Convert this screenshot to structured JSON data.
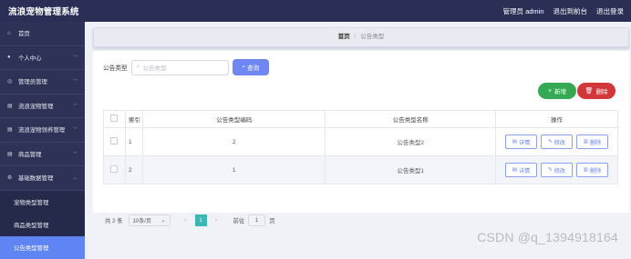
{
  "app": {
    "title": "流浪宠物管理系统"
  },
  "topbar": {
    "user_text": "管理员 admin",
    "to_front": "退出到前台",
    "logout": "退出登录"
  },
  "sidebar": {
    "items": [
      {
        "label": "首页",
        "icon": "home-icon"
      },
      {
        "label": "个人中心",
        "icon": "user-icon"
      },
      {
        "label": "管理员管理",
        "icon": "admin-icon"
      },
      {
        "label": "流浪宠物管理",
        "icon": "list-icon"
      },
      {
        "label": "流浪宠物领养管理",
        "icon": "list-icon"
      },
      {
        "label": "商品管理",
        "icon": "list-icon"
      },
      {
        "label": "基础数据管理",
        "icon": "settings-icon"
      }
    ],
    "sub_items": [
      {
        "label": "宠物类型管理"
      },
      {
        "label": "商品类型管理"
      },
      {
        "label": "公告类型管理",
        "active": true
      }
    ]
  },
  "breadcrumb": {
    "home": "首页",
    "separator": "/",
    "current": "公告类型"
  },
  "search": {
    "label": "公告类型",
    "placeholder": "公告类型",
    "button": "查询"
  },
  "actions": {
    "add": "新增",
    "delete": "删除"
  },
  "table": {
    "headers": {
      "index": "索引",
      "code": "公告类型编码",
      "name": "公告类型名称",
      "ops": "操作"
    },
    "rows": [
      {
        "index": "1",
        "code": "2",
        "name": "公告类型2"
      },
      {
        "index": "2",
        "code": "1",
        "name": "公告类型1"
      }
    ],
    "row_buttons": {
      "detail": "详情",
      "edit": "修改",
      "delete": "删除"
    }
  },
  "pagination": {
    "total": "共 2 条",
    "page_size": "10条/页",
    "current_page": "1",
    "goto_label": "前往",
    "goto_value": "1",
    "page_unit": "页"
  },
  "watermark": "CSDN @q_1394918164",
  "colors": {
    "sidebar": "#2d3256",
    "topbar": "#2b2f55",
    "active": "#5f84f3",
    "search_btn": "#6e87f5",
    "add_btn": "#35a853",
    "delete_btn": "#d2373a",
    "page_active": "#3cb7b4"
  }
}
